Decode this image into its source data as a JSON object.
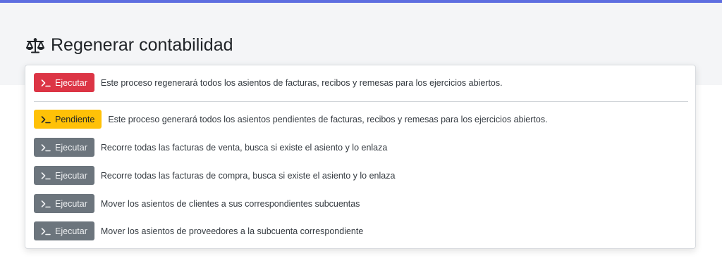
{
  "page": {
    "title": "Regenerar contabilidad",
    "accent_color": "#5e6ee0"
  },
  "actions": {
    "regenerate": {
      "button_label": "Ejecutar",
      "button_color": "#dc3545",
      "description": "Este proceso regenerará todos los asientos de facturas, recibos y remesas para los ejercicios abiertos."
    },
    "pending": {
      "button_label": "Pendiente",
      "button_color": "#ffc107",
      "description": "Este proceso generará todos los asientos pendientes de facturas, recibos y remesas para los ejercicios abiertos."
    },
    "link_sales": {
      "button_label": "Ejecutar",
      "button_color": "#6c757d",
      "description": "Recorre todas las facturas de venta, busca si existe el asiento y lo enlaza"
    },
    "link_purchases": {
      "button_label": "Ejecutar",
      "button_color": "#6c757d",
      "description": "Recorre todas las facturas de compra, busca si existe el asiento y lo enlaza"
    },
    "move_customers": {
      "button_label": "Ejecutar",
      "button_color": "#6c757d",
      "description": "Mover los asientos de clientes a sus correspondientes subcuentas"
    },
    "move_suppliers": {
      "button_label": "Ejecutar",
      "button_color": "#6c757d",
      "description": "Mover los asientos de proveedores a la subcuenta correspondiente"
    }
  },
  "icons": {
    "title_icon": "balance-scale-icon",
    "button_icon": "terminal-icon"
  }
}
